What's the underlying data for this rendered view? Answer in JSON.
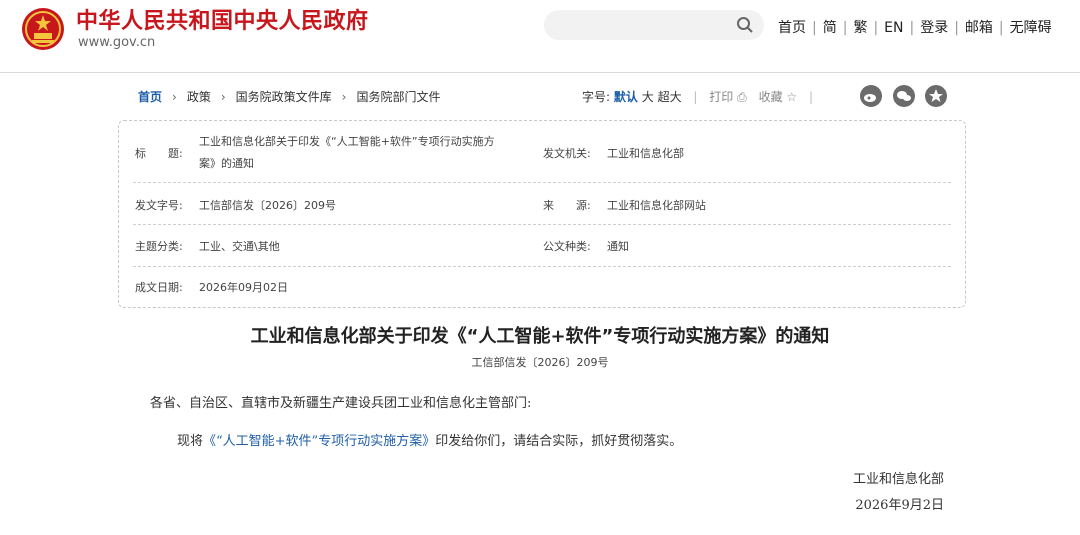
{
  "header": {
    "site_title": "中华人民共和国中央人民政府",
    "site_domain": "www.gov.cn",
    "search_placeholder": "",
    "nav": [
      "首页",
      "简",
      "繁",
      "EN",
      "登录",
      "邮箱",
      "无障碍"
    ]
  },
  "breadcrumb": [
    "首页",
    "政策",
    "国务院政策文件库",
    "国务院部门文件"
  ],
  "tools": {
    "font_label": "字号:",
    "font_default": "默认",
    "font_large": "大",
    "font_xlarge": "超大",
    "print": "打印",
    "favorite": "收藏"
  },
  "info": {
    "title_label": "标　　题:",
    "title_value_line1": "工业和信息化部关于印发《“人工智能+软件”专项行动实施方",
    "title_value_line2": "案》的通知",
    "issuer_label": "发文机关:",
    "issuer_value": "工业和信息化部",
    "docno_label": "发文字号:",
    "docno_value": "工信部信发〔2026〕209号",
    "source_label": "来　　源:",
    "source_value": "工业和信息化部网站",
    "topic_label": "主题分类:",
    "topic_value": "工业、交通\\其他",
    "type_label": "公文种类:",
    "type_value": "通知",
    "date_label": "成文日期:",
    "date_value": "2026年09月02日"
  },
  "document": {
    "title": "工业和信息化部关于印发《“人工智能+软件”专项行动实施方案》的通知",
    "number": "工信部信发〔2026〕209号",
    "recipients": "各省、自治区、直辖市及新疆生产建设兵团工业和信息化主管部门:",
    "body_prefix": "现将",
    "body_link": "《“人工智能+软件”专项行动实施方案》",
    "body_suffix": "印发给你们，请结合实际，抓好贯彻落实。",
    "signature": "工业和信息化部",
    "sign_date": "2026年9月2日"
  },
  "colors": {
    "brand_red": "#c8161d",
    "link_blue": "#1e5ea8"
  }
}
